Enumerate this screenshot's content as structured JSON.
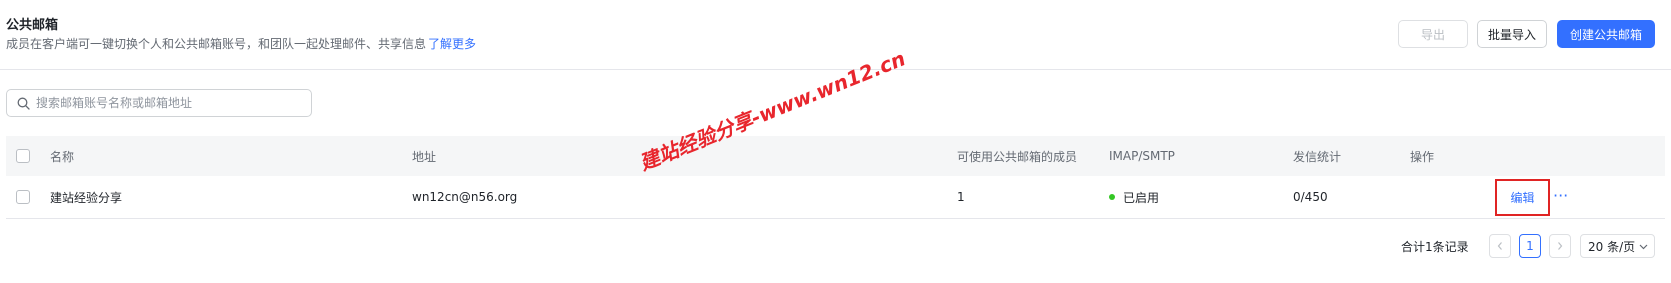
{
  "header": {
    "title": "公共邮箱",
    "description": "成员在客户端可一键切换个人和公共邮箱账号，和团队一起处理邮件、共享信息",
    "learn_more": "了解更多"
  },
  "toolbar": {
    "export_label": "导出",
    "batch_import_label": "批量导入",
    "create_label": "创建公共邮箱"
  },
  "search": {
    "placeholder": "搜索邮箱账号名称或邮箱地址",
    "value": ""
  },
  "table": {
    "columns": [
      "名称",
      "地址",
      "可使用公共邮箱的成员",
      "IMAP/SMTP",
      "发信统计",
      "操作"
    ],
    "rows": [
      {
        "name": "建站经验分享",
        "address": "wn12cn@n56.org",
        "members": "1",
        "imap_status": "已启用",
        "send_stats": "0/450",
        "edit_label": "编辑",
        "more_label": "···"
      }
    ]
  },
  "pagination": {
    "total_text": "合计1条记录",
    "current_page": "1",
    "page_size": "20 条/页"
  },
  "watermark": "建站经验分享-www.wn12.cn",
  "colors": {
    "accent": "#3370ff",
    "status_enabled": "#34c724",
    "highlight_border": "#e02424",
    "watermark": "#e8262d"
  },
  "icons": [
    "search-icon",
    "checkbox-icon",
    "status-dot-icon",
    "more-icon",
    "chevron-left-icon",
    "chevron-right-icon",
    "chevron-down-icon"
  ]
}
